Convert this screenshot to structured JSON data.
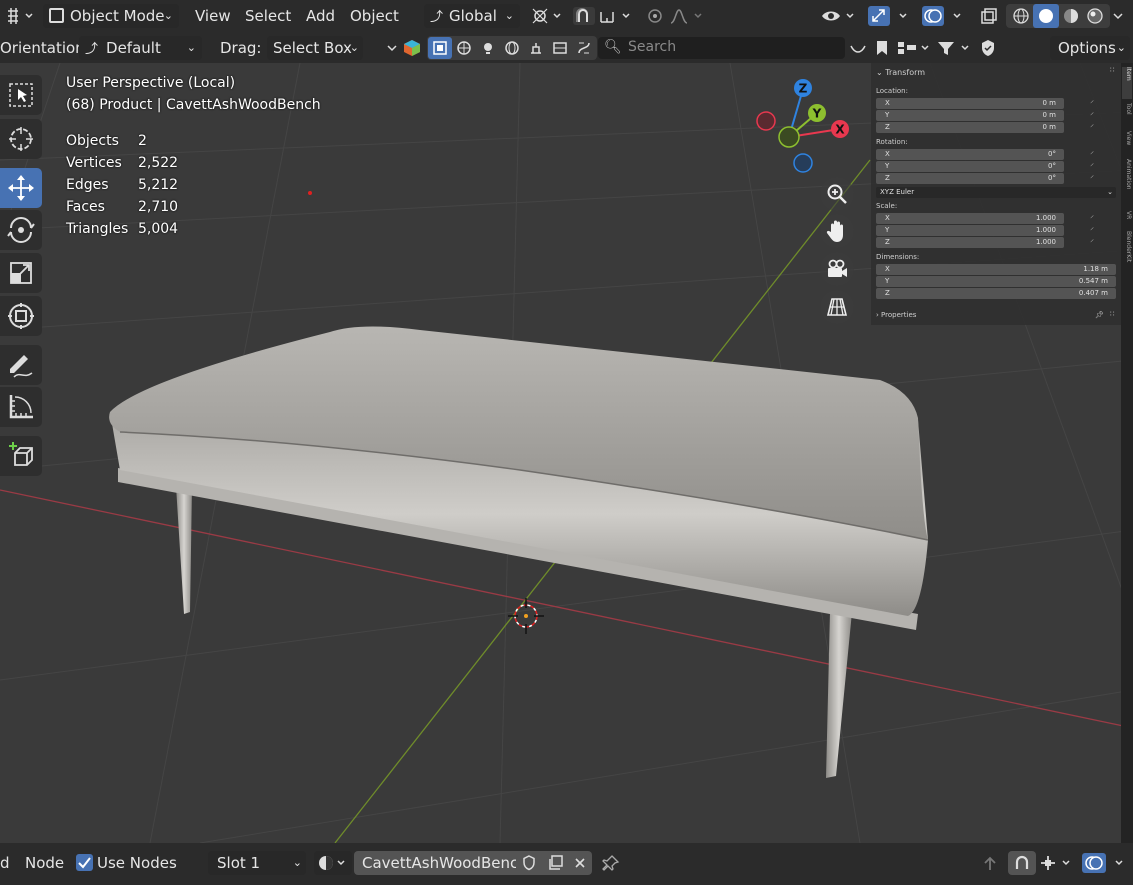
{
  "header": {
    "mode_label": "Object Mode",
    "menus": [
      "View",
      "Select",
      "Add",
      "Object"
    ],
    "transform_orientation": "Global"
  },
  "toolbar_row": {
    "orientation_label": "Orientation:",
    "orientation_value": "Default",
    "drag_label": "Drag:",
    "drag_value": "Select Box",
    "search_placeholder": "Search",
    "options_label": "Options"
  },
  "viewport": {
    "view_name": "User Perspective (Local)",
    "object_info": "(68) Product | CavettAshWoodBench",
    "stats": [
      {
        "label": "Objects",
        "value": "2"
      },
      {
        "label": "Vertices",
        "value": "2,522"
      },
      {
        "label": "Edges",
        "value": "5,212"
      },
      {
        "label": "Faces",
        "value": "2,710"
      },
      {
        "label": "Triangles",
        "value": "5,004"
      }
    ],
    "gizmo_axes": [
      "Z",
      "Y",
      "X"
    ]
  },
  "npanel": {
    "transform_title": "Transform",
    "location_label": "Location:",
    "location": [
      {
        "axis": "X",
        "value": "0 m"
      },
      {
        "axis": "Y",
        "value": "0 m"
      },
      {
        "axis": "Z",
        "value": "0 m"
      }
    ],
    "rotation_label": "Rotation:",
    "rotation": [
      {
        "axis": "X",
        "value": "0°"
      },
      {
        "axis": "Y",
        "value": "0°"
      },
      {
        "axis": "Z",
        "value": "0°"
      }
    ],
    "rotation_mode": "XYZ Euler",
    "scale_label": "Scale:",
    "scale": [
      {
        "axis": "X",
        "value": "1.000"
      },
      {
        "axis": "Y",
        "value": "1.000"
      },
      {
        "axis": "Z",
        "value": "1.000"
      }
    ],
    "dimensions_label": "Dimensions:",
    "dimensions": [
      {
        "axis": "X",
        "value": "1.18 m"
      },
      {
        "axis": "Y",
        "value": "0.547 m"
      },
      {
        "axis": "Z",
        "value": "0.407 m"
      }
    ],
    "properties_label": "Properties",
    "tabs": [
      "Item",
      "Tool",
      "View",
      "Animation",
      "VR",
      "BlenderKit"
    ]
  },
  "bottom": {
    "edge_label": "d",
    "node_label": "Node",
    "use_nodes_label": "Use Nodes",
    "slot_label": "Slot 1",
    "material_name": "CavettAshWoodBench"
  },
  "colors": {
    "accent": "#4772b3",
    "axis_x": "#e8384f",
    "axis_y": "#8dbf2f",
    "axis_z": "#2f83e0"
  }
}
